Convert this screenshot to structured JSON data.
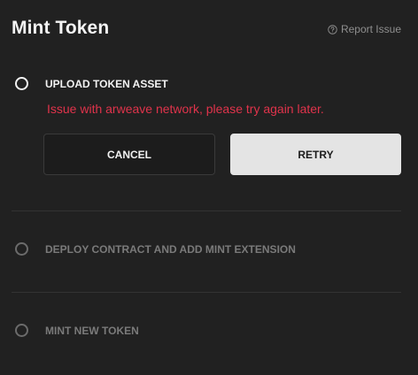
{
  "dialog": {
    "title": "Mint Token",
    "report_link": {
      "label": "Report Issue",
      "icon": "help-circle-icon"
    }
  },
  "steps": [
    {
      "label": "UPLOAD TOKEN ASSET",
      "state": "active",
      "error": "Issue with arweave network, please try again later."
    },
    {
      "label": "DEPLOY CONTRACT AND ADD MINT EXTENSION",
      "state": "pending"
    },
    {
      "label": "MINT NEW TOKEN",
      "state": "pending"
    }
  ],
  "actions": {
    "cancel_label": "CANCEL",
    "retry_label": "RETRY"
  },
  "colors": {
    "background": "#212121",
    "error": "#e0334b",
    "primary_button": "#e4e4e4",
    "muted_text": "#7a7a7a"
  }
}
